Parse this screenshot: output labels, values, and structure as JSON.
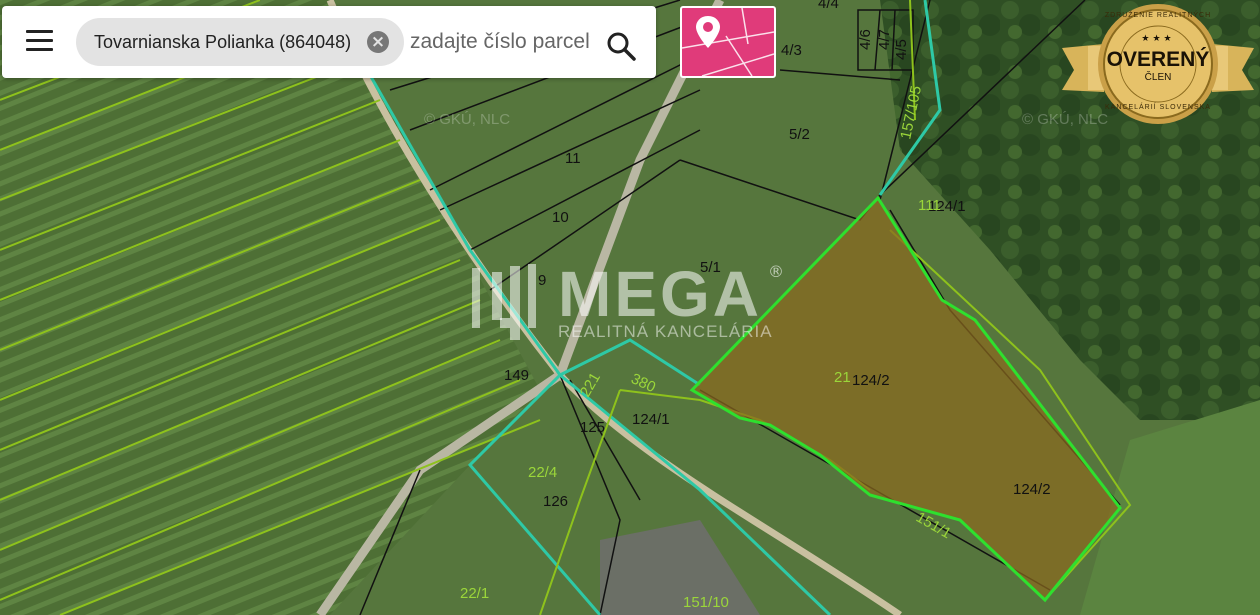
{
  "search": {
    "chip_label": "Tovarnianska Polianka (864048)",
    "placeholder": "zadajte číslo parcely"
  },
  "watermark": {
    "brand": "MEGA",
    "registered": "®",
    "tagline": "REALITNÁ KANCELÁRIA",
    "map_copyright": "© GKÚ, NLC"
  },
  "badge": {
    "title": "OVERENÝ",
    "subtitle": "ČLEN",
    "top_text": "ZDRUŽENIE REALITNÝCH",
    "bottom_text": "KANCELÁRIÍ SLOVENSKA",
    "stars": "★★★"
  },
  "parcels": {
    "black_labels": [
      "4/4",
      "4/3",
      "4/6",
      "4/7",
      "4/5",
      "5/2",
      "11",
      "10",
      "9",
      "5/1",
      "124/1",
      "124/2",
      "124/2",
      "149",
      "125",
      "124/1",
      "126"
    ],
    "green_labels": [
      "157/105",
      "111",
      "380",
      "22/4",
      "22/1",
      "151/1",
      "21",
      "151/10",
      "221"
    ]
  },
  "icons": {
    "menu": "hamburger-menu-icon",
    "clear": "clear-x-icon",
    "search": "magnifier-icon",
    "layer": "location-pin-parcel-icon"
  },
  "colors": {
    "selected_parcel_fill": "#8a6a1e",
    "selected_parcel_outline": "#2ee02e",
    "cadastre_c_line": "#2ec9a6",
    "cadastre_e_line": "#8ec21c",
    "layer_button": "#e03b7a"
  }
}
